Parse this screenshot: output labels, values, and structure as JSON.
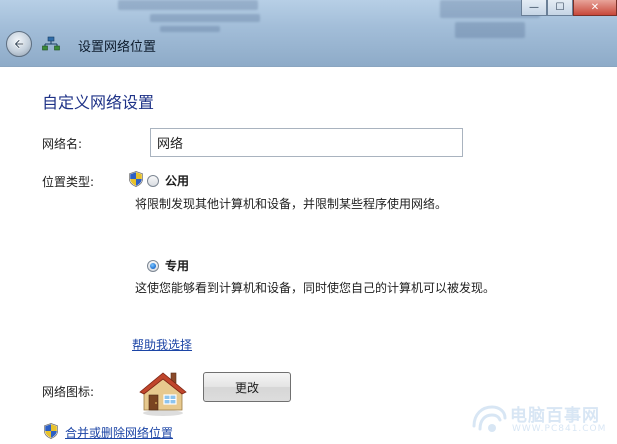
{
  "window": {
    "title": "设置网络位置",
    "controls": {
      "minimize_glyph": "—",
      "maximize_glyph": "☐",
      "close_glyph": "✕"
    }
  },
  "page": {
    "heading": "自定义网络设置",
    "network_name": {
      "label": "网络名:",
      "value": "网络"
    },
    "location_type": {
      "label": "位置类型:",
      "options": [
        {
          "label": "公用",
          "selected": false,
          "description": "将限制发现其他计算机和设备，并限制某些程序使用网络。"
        },
        {
          "label": "专用",
          "selected": true,
          "description": "这使您能够看到计算机和设备，同时使您自己的计算机可以被发现。"
        }
      ]
    },
    "help_link": "帮助我选择",
    "network_icon": {
      "label": "网络图标:",
      "change_button": "更改"
    },
    "merge_link": "合并或删除网络位置"
  },
  "watermark": {
    "name": "电脑百事网",
    "url": "WWW.PC841.COM"
  },
  "colors": {
    "heading": "#1e3287",
    "link": "#1c45a6",
    "titlebar": "#a3bed9"
  },
  "icons": {
    "back": "back-arrow-icon",
    "network": "network-icon",
    "shield": "uac-shield-icon",
    "house": "home-network-icon"
  }
}
